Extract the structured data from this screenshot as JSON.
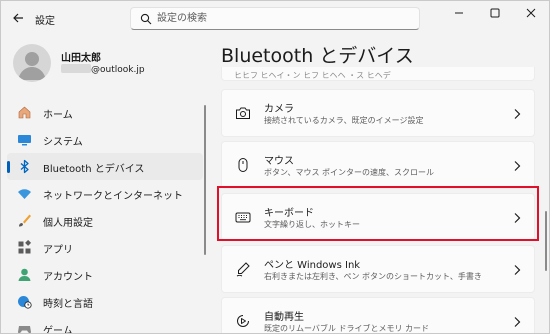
{
  "app": {
    "title": "設定",
    "search_placeholder": "設定の検索"
  },
  "profile": {
    "name": "山田太郎",
    "email_suffix": "@outlook.jp"
  },
  "sidebar": {
    "items": [
      {
        "label": "ホーム",
        "icon": "home-icon",
        "active": false
      },
      {
        "label": "システム",
        "icon": "system-icon",
        "active": false
      },
      {
        "label": "Bluetooth とデバイス",
        "icon": "bluetooth-icon",
        "active": true
      },
      {
        "label": "ネットワークとインターネット",
        "icon": "wifi-icon",
        "active": false
      },
      {
        "label": "個人用設定",
        "icon": "brush-icon",
        "active": false
      },
      {
        "label": "アプリ",
        "icon": "apps-icon",
        "active": false
      },
      {
        "label": "アカウント",
        "icon": "account-icon",
        "active": false
      },
      {
        "label": "時刻と言語",
        "icon": "globe-clock-icon",
        "active": false
      },
      {
        "label": "ゲーム",
        "icon": "game-icon",
        "active": false
      }
    ]
  },
  "main": {
    "page_title": "Bluetooth とデバイス",
    "partial_top_text": "ヒヒフ ヒヘイ・ン ヒフ ヒヘヘ ・ス ヒヘデ",
    "cards": [
      {
        "title": "カメラ",
        "desc": "接続されているカメラ、既定のイメージ設定",
        "icon": "camera-icon"
      },
      {
        "title": "マウス",
        "desc": "ボタン、マウス ポインターの速度、スクロール",
        "icon": "mouse-icon"
      },
      {
        "title": "キーボード",
        "desc": "文字繰り返し、ホットキー",
        "icon": "keyboard-icon",
        "highlighted": true
      },
      {
        "title": "ペンと Windows Ink",
        "desc": "右利きまたは左利き、ペン ボタンのショートカット、手書き",
        "icon": "pen-icon"
      },
      {
        "title": "自動再生",
        "desc": "既定のリムーバブル ドライブとメモリ カード",
        "icon": "autoplay-icon"
      }
    ]
  },
  "colors": {
    "accent": "#005fb8",
    "highlight_border": "#e0102b",
    "background": "#f3f3f3",
    "card": "#fbfbfb"
  }
}
